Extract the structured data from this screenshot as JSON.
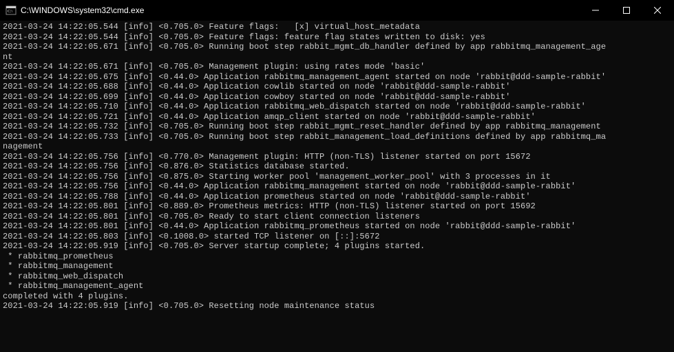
{
  "window": {
    "title": "C:\\WINDOWS\\system32\\cmd.exe"
  },
  "console": {
    "lines": [
      "2021-03-24 14:22:05.544 [info] <0.705.0> Feature flags:   [x] virtual_host_metadata",
      "2021-03-24 14:22:05.544 [info] <0.705.0> Feature flags: feature flag states written to disk: yes",
      "2021-03-24 14:22:05.671 [info] <0.705.0> Running boot step rabbit_mgmt_db_handler defined by app rabbitmq_management_age",
      "nt",
      "2021-03-24 14:22:05.671 [info] <0.705.0> Management plugin: using rates mode 'basic'",
      "2021-03-24 14:22:05.675 [info] <0.44.0> Application rabbitmq_management_agent started on node 'rabbit@ddd-sample-rabbit'",
      "2021-03-24 14:22:05.688 [info] <0.44.0> Application cowlib started on node 'rabbit@ddd-sample-rabbit'",
      "2021-03-24 14:22:05.699 [info] <0.44.0> Application cowboy started on node 'rabbit@ddd-sample-rabbit'",
      "2021-03-24 14:22:05.710 [info] <0.44.0> Application rabbitmq_web_dispatch started on node 'rabbit@ddd-sample-rabbit'",
      "2021-03-24 14:22:05.721 [info] <0.44.0> Application amqp_client started on node 'rabbit@ddd-sample-rabbit'",
      "2021-03-24 14:22:05.732 [info] <0.705.0> Running boot step rabbit_mgmt_reset_handler defined by app rabbitmq_management",
      "2021-03-24 14:22:05.733 [info] <0.705.0> Running boot step rabbit_management_load_definitions defined by app rabbitmq_ma",
      "nagement",
      "2021-03-24 14:22:05.756 [info] <0.770.0> Management plugin: HTTP (non-TLS) listener started on port 15672",
      "2021-03-24 14:22:05.756 [info] <0.876.0> Statistics database started.",
      "2021-03-24 14:22:05.756 [info] <0.875.0> Starting worker pool 'management_worker_pool' with 3 processes in it",
      "2021-03-24 14:22:05.756 [info] <0.44.0> Application rabbitmq_management started on node 'rabbit@ddd-sample-rabbit'",
      "2021-03-24 14:22:05.788 [info] <0.44.0> Application prometheus started on node 'rabbit@ddd-sample-rabbit'",
      "2021-03-24 14:22:05.801 [info] <0.889.0> Prometheus metrics: HTTP (non-TLS) listener started on port 15692",
      "2021-03-24 14:22:05.801 [info] <0.705.0> Ready to start client connection listeners",
      "2021-03-24 14:22:05.801 [info] <0.44.0> Application rabbitmq_prometheus started on node 'rabbit@ddd-sample-rabbit'",
      "2021-03-24 14:22:05.803 [info] <0.1008.0> started TCP listener on [::]:5672",
      "2021-03-24 14:22:05.919 [info] <0.705.0> Server startup complete; 4 plugins started.",
      " * rabbitmq_prometheus",
      " * rabbitmq_management",
      " * rabbitmq_web_dispatch",
      " * rabbitmq_management_agent",
      "completed with 4 plugins.",
      "2021-03-24 14:22:05.919 [info] <0.705.0> Resetting node maintenance status"
    ]
  }
}
